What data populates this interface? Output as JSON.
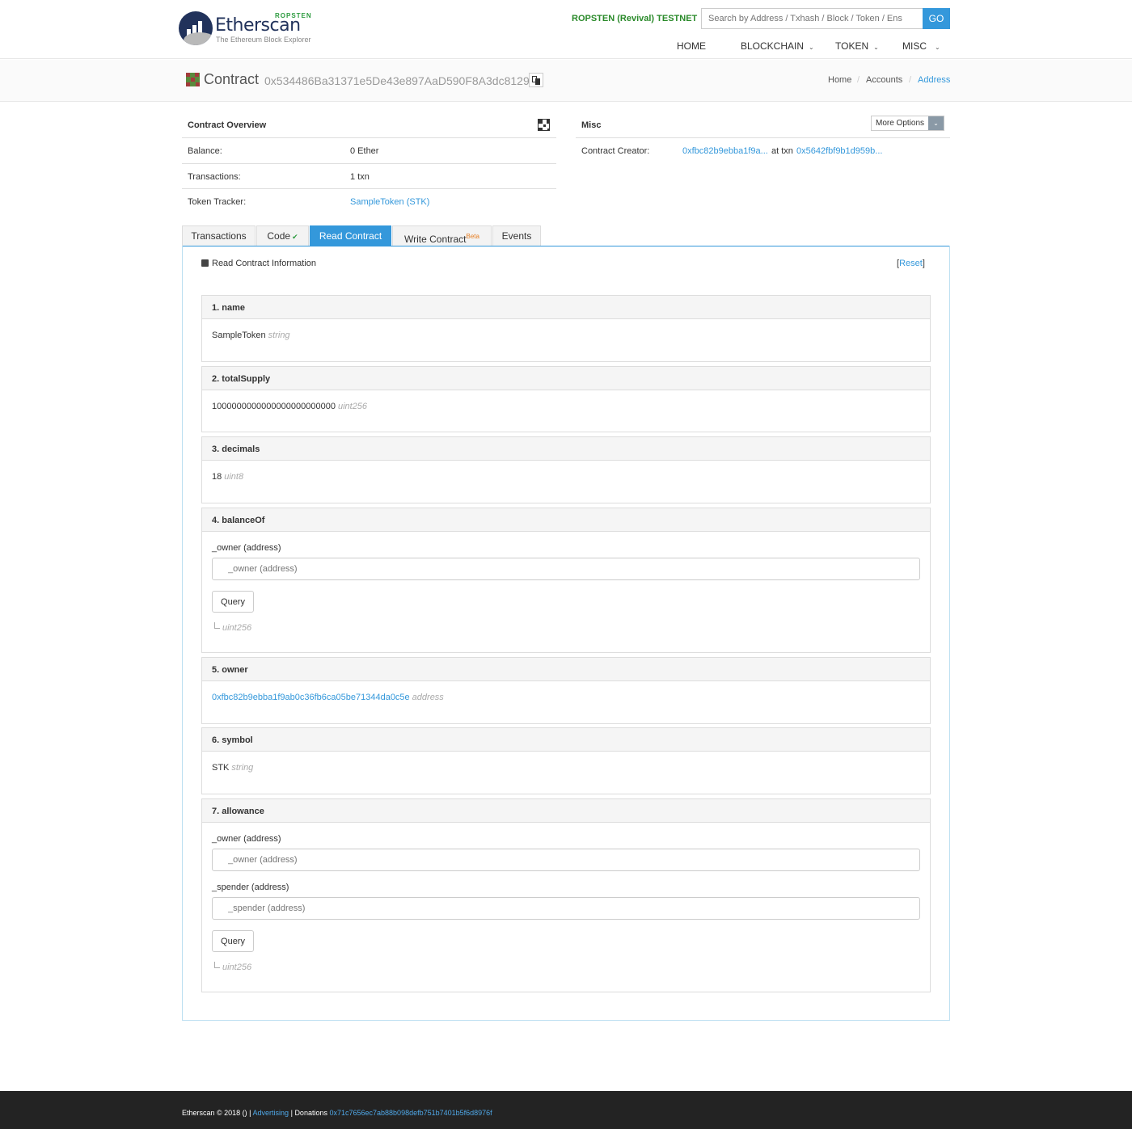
{
  "header": {
    "logo_name": "Etherscan",
    "logo_badge": "ROPSTEN",
    "logo_tagline": "The Ethereum Block Explorer",
    "network": "ROPSTEN (Revival) TESTNET",
    "search_placeholder": "Search by Address / Txhash / Block / Token / Ens",
    "go_label": "GO",
    "nav": [
      {
        "label": "HOME",
        "dropdown": false
      },
      {
        "label": "BLOCKCHAIN",
        "dropdown": true
      },
      {
        "label": "TOKEN",
        "dropdown": true
      },
      {
        "label": "MISC",
        "dropdown": true
      }
    ],
    "accent_color": "#3498db"
  },
  "page": {
    "title": "Contract",
    "address": "0x534486Ba31371e5De43e897AaD590F8A3dc8129b",
    "breadcrumbs": [
      "Home",
      "Accounts",
      "Address"
    ]
  },
  "overview": {
    "title": "Contract Overview",
    "rows": [
      {
        "label": "Balance:",
        "value": "0 Ether"
      },
      {
        "label": "Transactions:",
        "value": "1 txn"
      },
      {
        "label": "Token Tracker:",
        "value": "SampleToken (STK)"
      }
    ]
  },
  "misc": {
    "title": "Misc",
    "more_options": "More Options",
    "creator_label": "Contract Creator:",
    "creator_address": "0xfbc82b9ebba1f9a...",
    "at_txn": "at txn",
    "creator_txn": "0x5642fbf9b1d959b..."
  },
  "tabs": [
    {
      "label": "Transactions",
      "badge": ""
    },
    {
      "label": "Code",
      "badge": "check-circle-icon"
    },
    {
      "label": "Read Contract",
      "badge": ""
    },
    {
      "label": "Write Contract",
      "badge": "Beta"
    },
    {
      "label": "Events",
      "badge": ""
    }
  ],
  "read_contract": {
    "heading": "Read Contract Information",
    "reset_label": "Reset",
    "functions": [
      {
        "title": "1. name",
        "value": "SampleToken",
        "type": "string"
      },
      {
        "title": "2. totalSupply",
        "value": "1000000000000000000000000",
        "type": "uint256"
      },
      {
        "title": "3. decimals",
        "value": "18",
        "type": "uint8"
      },
      {
        "title": "4. balanceOf",
        "input_label": "_owner (address)",
        "input_placeholder": "_owner (address)",
        "query_label": "Query",
        "return_type": "uint256"
      },
      {
        "title": "5. owner",
        "value": "0xfbc82b9ebba1f9ab0c36fb6ca05be71344da0c5e",
        "type": "address"
      },
      {
        "title": "6. symbol",
        "value": "STK",
        "type": "string"
      },
      {
        "title": "7. allowance",
        "inputs": [
          {
            "label": "_owner (address)",
            "placeholder": "_owner (address)"
          },
          {
            "label": "_spender (address)",
            "placeholder": "_spender (address)"
          }
        ],
        "query_label": "Query",
        "return_type": "uint256"
      }
    ]
  },
  "footer": {
    "copyright": "Etherscan © 2018 () |",
    "advertising": "Advertising",
    "sep": "|",
    "donations_label": "Donations",
    "donations_address": "0x71c7656ec7ab88b098defb751b7401b5f6d8976f"
  }
}
